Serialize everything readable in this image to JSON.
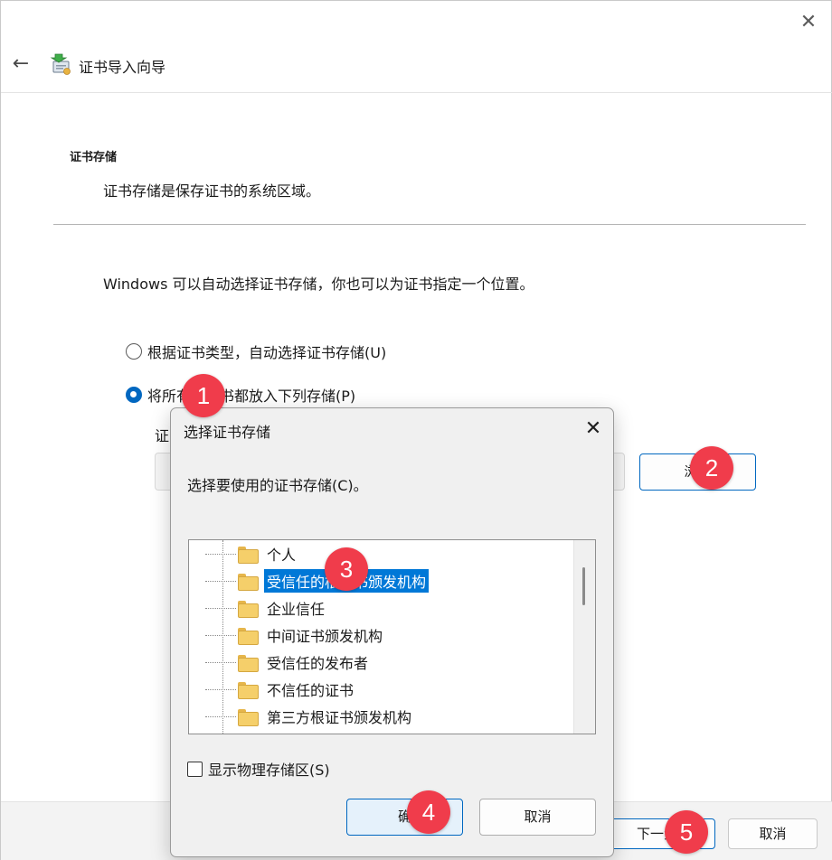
{
  "window": {
    "close_glyph": "✕",
    "back_glyph": "←",
    "title": "证书导入向导",
    "icon": "certificate-wizard-icon"
  },
  "page": {
    "section_title": "证书存储",
    "section_desc": "证书存储是保存证书的系统区域。",
    "intro": "Windows 可以自动选择证书存储，你也可以为证书指定一个位置。",
    "option_auto": "根据证书类型，自动选择证书存储(U)",
    "option_manual": "将所有的证书都放入下列存储(P)",
    "store_label": "证",
    "store_value": "",
    "browse_label": "浏览",
    "next_label": "下一步",
    "cancel_label": "取消"
  },
  "dialog": {
    "title": "选择证书存储",
    "close_glyph": "✕",
    "prompt": "选择要使用的证书存储(C)。",
    "items": [
      "个人",
      "受信任的根证书颁发机构",
      "企业信任",
      "中间证书颁发机构",
      "受信任的发布者",
      "不信任的证书",
      "第三方根证书颁发机构"
    ],
    "selected_index": 1,
    "show_physical": "显示物理存储区(S)",
    "ok_label": "确",
    "cancel_label": "取消"
  },
  "badges": [
    "1",
    "2",
    "3",
    "4",
    "5"
  ],
  "colors": {
    "accent": "#0067c0",
    "selection": "#0078d7",
    "badge": "#f03c4b"
  }
}
